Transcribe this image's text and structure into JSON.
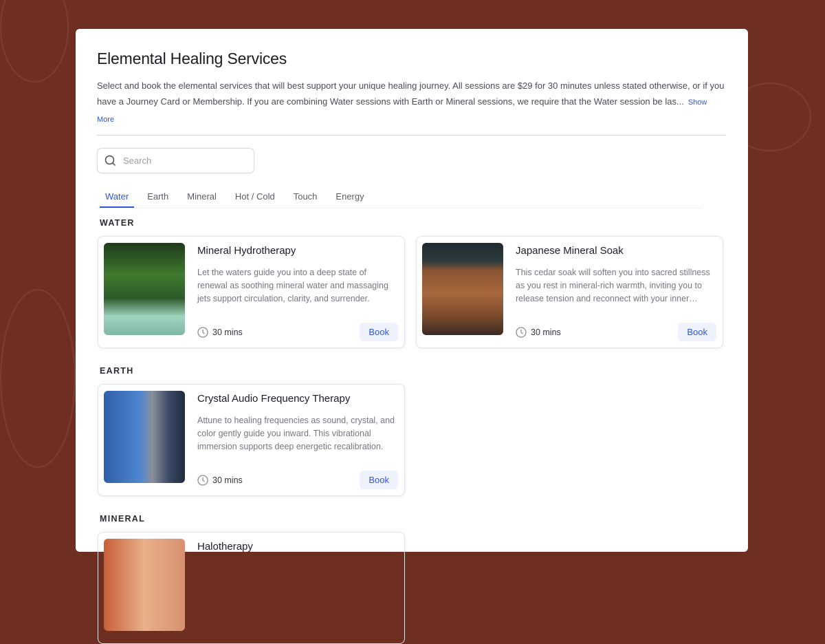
{
  "header": {
    "title": "Elemental Healing Services",
    "description": "Select and book the elemental services that will best support your unique healing journey. All sessions are $29 for 30 minutes unless stated otherwise, or if you have a Journey Card or Membership. If you are combining Water sessions with Earth or Mineral sessions, we require that the Water session be las...",
    "show_more": "Show More"
  },
  "search": {
    "placeholder": "Search",
    "value": ""
  },
  "tabs": [
    {
      "label": "Water"
    },
    {
      "label": "Earth"
    },
    {
      "label": "Mineral"
    },
    {
      "label": "Hot / Cold"
    },
    {
      "label": "Touch"
    },
    {
      "label": "Energy"
    }
  ],
  "sections": [
    {
      "heading": "WATER",
      "services": [
        {
          "title": "Mineral Hydrotherapy",
          "description": "Let the waters guide you into a deep state of renewal as soothing mineral water and massaging jets support circulation, clarity, and surrender.",
          "duration": "30 mins",
          "book": "Book"
        },
        {
          "title": "Japanese Mineral Soak",
          "description": "This cedar soak will soften you into sacred stillness as you rest in mineral-rich warmth, inviting you to release tension and reconnect with your inner…",
          "duration": "30 mins",
          "book": "Book"
        }
      ]
    },
    {
      "heading": "EARTH",
      "services": [
        {
          "title": "Crystal Audio Frequency Therapy",
          "description": "Attune to healing frequencies as sound, crystal, and color gently guide you inward. This vibrational immersion supports deep energetic recalibration.",
          "duration": "30 mins",
          "book": "Book"
        }
      ]
    },
    {
      "heading": "MINERAL",
      "services": [
        {
          "title": "Halotherapy"
        }
      ]
    }
  ],
  "colors": {
    "accent": "#2f55d4",
    "background": "#6f2e22"
  }
}
